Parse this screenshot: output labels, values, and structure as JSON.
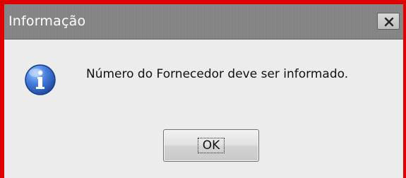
{
  "dialog": {
    "title": "Informação",
    "message": "Número do Fornecedor deve ser informado.",
    "ok_label": "OK"
  },
  "icons": {
    "close": "close-icon",
    "info": "info-icon"
  },
  "colors": {
    "frame_highlight": "#e10000",
    "titlebar": "#858585",
    "dialog_background": "#ececec",
    "info_blue": "#2f66c6"
  }
}
